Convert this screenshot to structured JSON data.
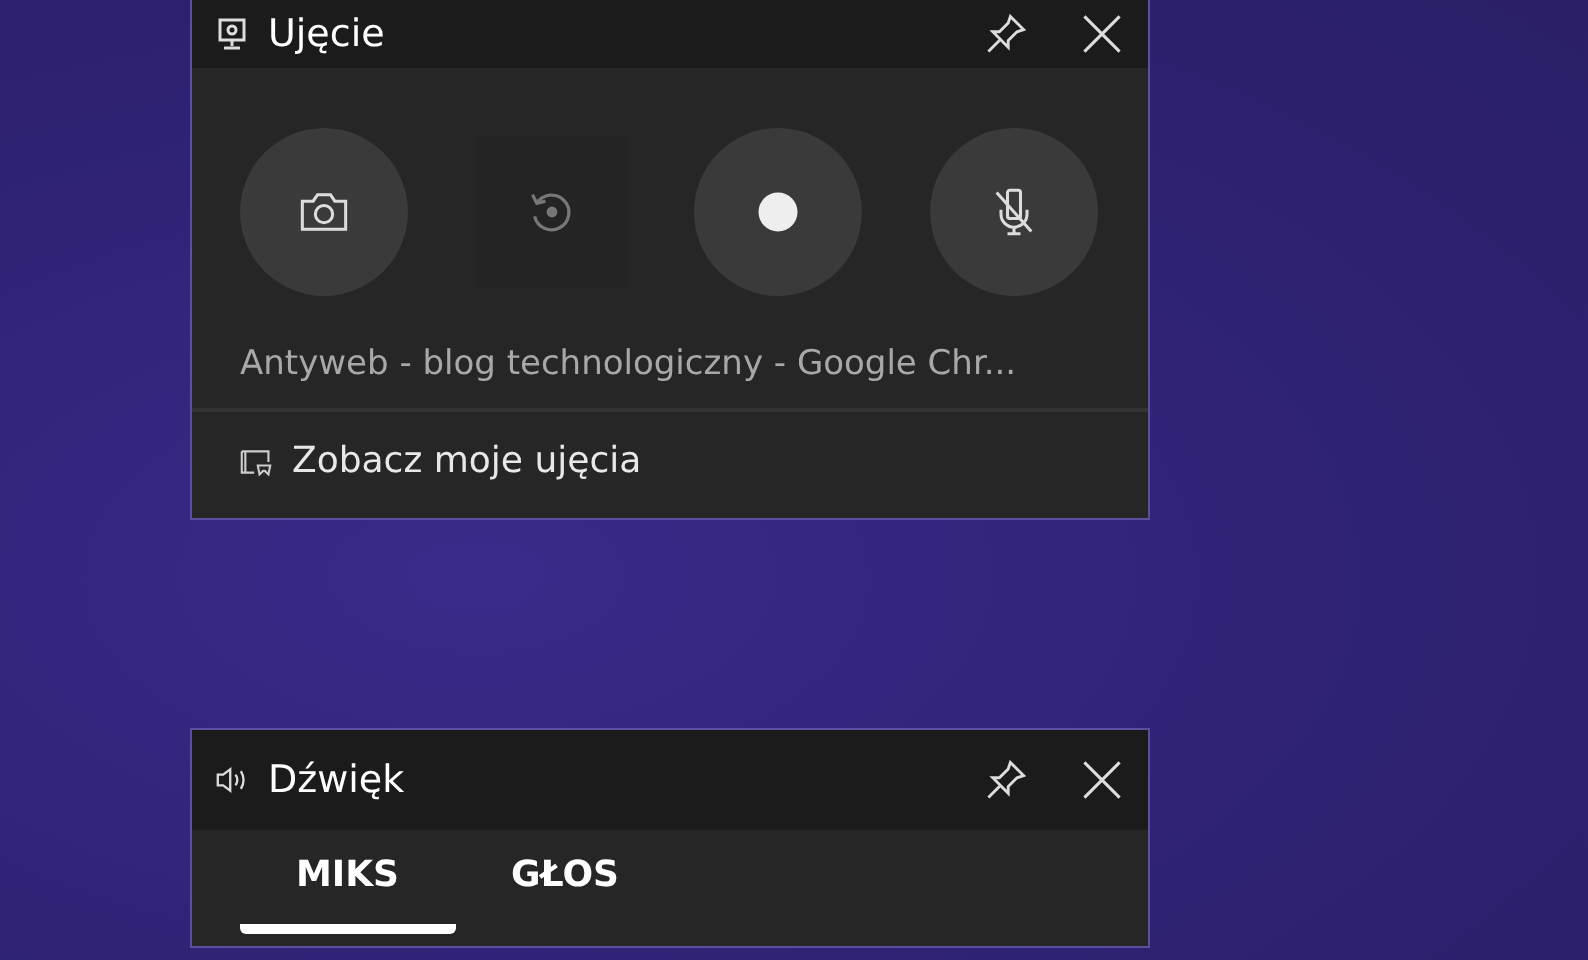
{
  "capture_widget": {
    "title": "Ujęcie",
    "buttons": [
      {
        "kind": "screenshot",
        "disabled": false
      },
      {
        "kind": "replay",
        "disabled": true
      },
      {
        "kind": "record",
        "disabled": false
      },
      {
        "kind": "mic",
        "disabled": false
      }
    ],
    "source": "Antyweb - blog technologiczny - Google Chr...",
    "link": "Zobacz moje ujęcia"
  },
  "audio_widget": {
    "title": "Dźwięk",
    "tabs": [
      {
        "label": "MIKS",
        "selected": true
      },
      {
        "label": "GŁOS",
        "selected": false
      }
    ]
  }
}
